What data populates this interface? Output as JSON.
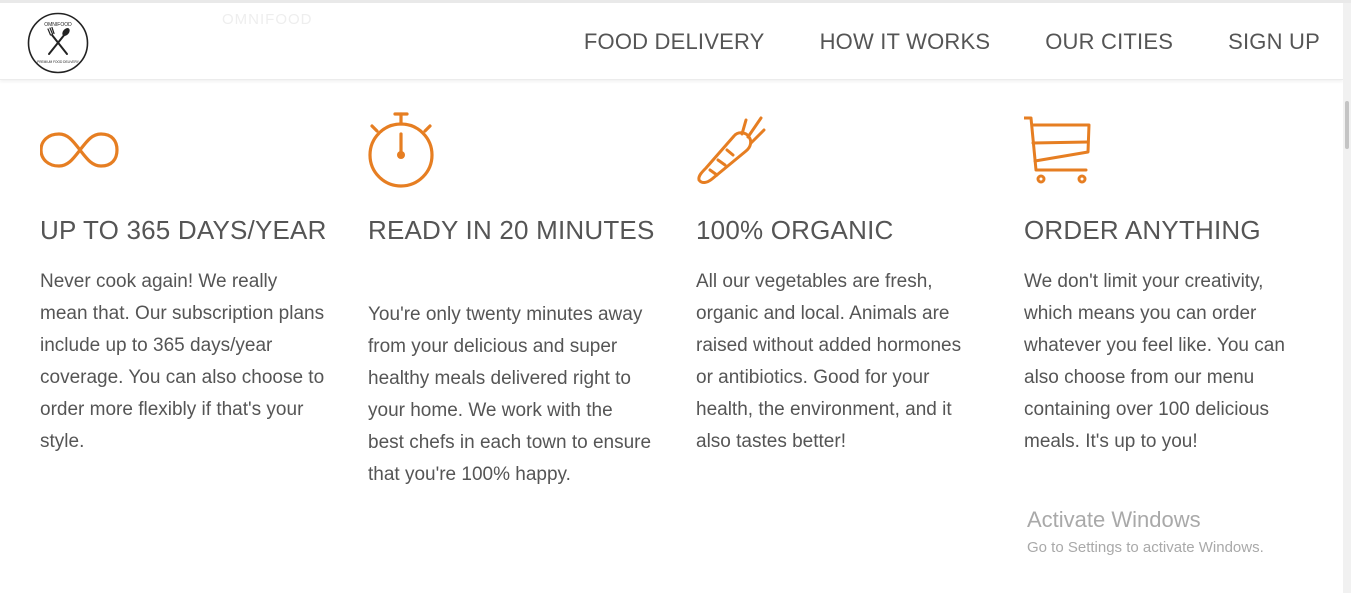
{
  "nav": {
    "logo_text_top": "OMNIFOOD",
    "logo_text_bottom": "PREMIUM FOOD DELIVERY",
    "ghost_text": "OMNIFOOD",
    "links": [
      {
        "label": "FOOD DELIVERY"
      },
      {
        "label": "HOW IT WORKS"
      },
      {
        "label": "OUR CITIES"
      },
      {
        "label": "SIGN UP"
      }
    ]
  },
  "features": [
    {
      "icon": "infinity-icon",
      "title": "UP TO 365 DAYS/YEAR",
      "text": "Never cook again! We really mean that. Our subscription plans include up to 365 days/year coverage. You can also choose to order more flexibly if that's your style."
    },
    {
      "icon": "stopwatch-icon",
      "title": "READY IN 20 MINUTES",
      "text": "You're only twenty minutes away from your delicious and super healthy meals delivered right to your home. We work with the best chefs in each town to ensure that you're 100% happy."
    },
    {
      "icon": "carrot-icon",
      "title": "100% ORGANIC",
      "text": "All our vegetables are fresh, organic and local. Animals are raised without added hormones or antibiotics. Good for your health, the environment, and it also tastes better!"
    },
    {
      "icon": "cart-icon",
      "title": "ORDER ANYTHING",
      "text": "We don't limit your creativity, which means you can order whatever you feel like. You can also choose from our menu containing over 100 delicious meals. It's up to you!"
    }
  ],
  "activation": {
    "title": "Activate Windows",
    "subtitle": "Go to Settings to activate Windows."
  },
  "colors": {
    "accent": "#e67e22",
    "text": "#555555",
    "watermark": "#a9a9a9"
  }
}
